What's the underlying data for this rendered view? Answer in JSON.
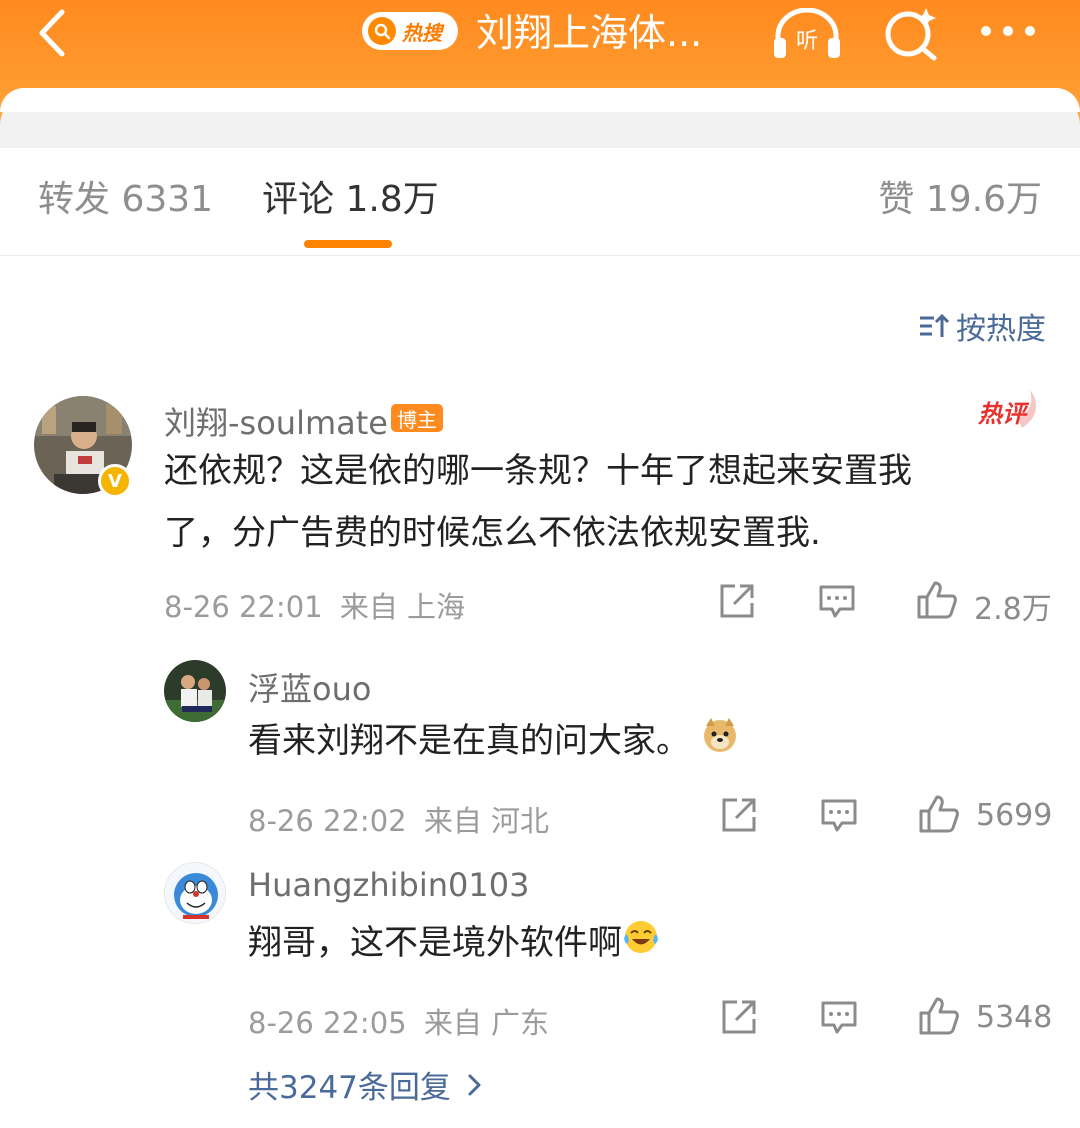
{
  "header": {
    "hot_search_label": "热搜",
    "title": "刘翔上海体...",
    "listen_label": "听"
  },
  "tabs": {
    "repost": "转发 6331",
    "comments": "评论 1.8万",
    "likes": "赞 19.6万"
  },
  "sort_label": "按热度",
  "main_comment": {
    "username": "刘翔-soulmate",
    "badge": "博主",
    "hot_label": "热评",
    "text_line1": "还依规？这是依的哪一条规？十年了想起来安置我",
    "text_line2": "了，分广告费的时候怎么不依法依规安置我.",
    "timestamp": "8-26 22:01",
    "location": "来自 上海",
    "likes": "2.8万"
  },
  "replies": [
    {
      "username": "浮蓝ouo",
      "text": "看来刘翔不是在真的问大家。",
      "emoji": "doge-emoji",
      "timestamp": "8-26 22:02",
      "location": "来自 河北",
      "likes": "5699"
    },
    {
      "username": "Huangzhibin0103",
      "text": "翔哥，这不是境外软件啊",
      "emoji": "laugh-cry-emoji",
      "timestamp": "8-26 22:05",
      "location": "来自 广东",
      "likes": "5348"
    }
  ],
  "more_replies": "共3247条回复",
  "colors": {
    "header_orange": "#ff8a1f",
    "tab_underline": "#ff8200",
    "link_blue": "#4a6a99",
    "hot_red": "#e8322f"
  }
}
